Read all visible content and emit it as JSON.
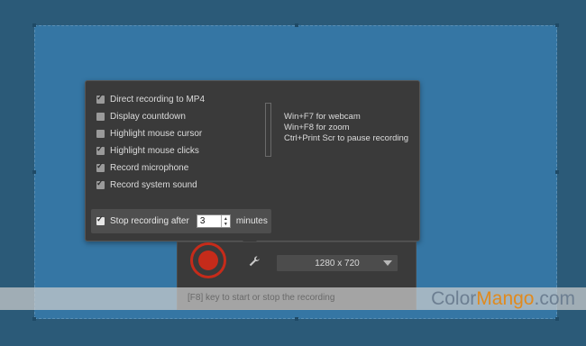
{
  "options": [
    {
      "label": "Direct recording to MP4",
      "checked": true
    },
    {
      "label": "Display countdown",
      "checked": false
    },
    {
      "label": "Highlight mouse cursor",
      "checked": false
    },
    {
      "label": "Highlight mouse clicks",
      "checked": true
    },
    {
      "label": "Record microphone",
      "checked": true
    },
    {
      "label": "Record system sound",
      "checked": true
    }
  ],
  "hotkeys": [
    "Win+F7 for webcam",
    "Win+F8 for zoom",
    "Ctrl+Print Scr to pause recording"
  ],
  "stop_after": {
    "label": "Stop recording after",
    "checked": true,
    "value": "3",
    "unit": "minutes"
  },
  "toolbar": {
    "resolution": "1280 x 720",
    "record_icon": "record-icon",
    "settings_icon": "wrench-icon"
  },
  "hint": "[F8] key to start or stop the recording",
  "watermark": {
    "prefix": "Color",
    "accent": "Mango",
    "suffix": ".com"
  },
  "colors": {
    "record": "#c62b1a",
    "capture_area": "#3576a4",
    "panel": "#3a3a3a"
  }
}
